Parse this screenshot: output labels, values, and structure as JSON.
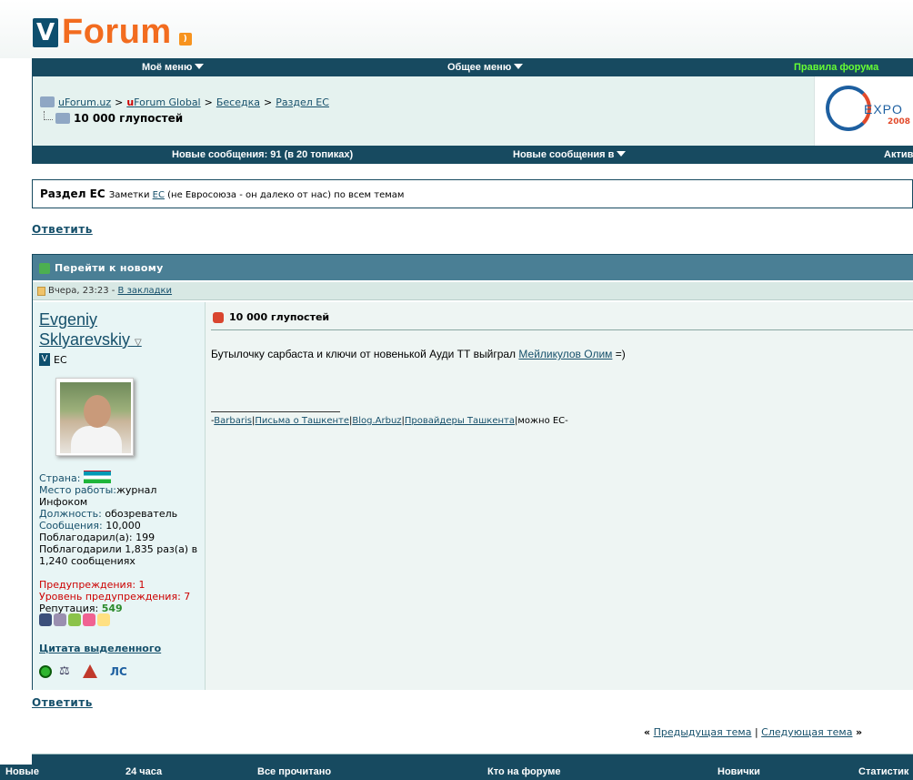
{
  "logo": {
    "mark": "V",
    "word": "Forum",
    "rss": "rss"
  },
  "menu": {
    "my_menu": "Моё меню",
    "general_menu": "Общее меню",
    "rules": "Правила форума",
    "rules_color": "#66ff33"
  },
  "breadcrumb": {
    "root": "uForum.uz",
    "global_u": "u",
    "global_rest": "Forum Global",
    "section1": "Беседка",
    "section2": "Раздел ЕС",
    "topic": "10 000 глупостей"
  },
  "banner": {
    "text": "EXPO",
    "year": "2008"
  },
  "statbar": {
    "new_posts": "Новые сообщения: 91 (в 20 топиках)",
    "new_in": "Новые сообщения в",
    "active": "Актив"
  },
  "section": {
    "title": "Раздел ЕС",
    "desc_pre": "Заметки ",
    "desc_link": "ЕС",
    "desc_post": " (не Евросоюза - он далеко от нас) по всем темам"
  },
  "reply_label": "Ответить",
  "post": {
    "header": "Перейти к новому",
    "date": "Вчера, 23:23 - ",
    "bookmark": "В закладки",
    "author_line1": "Evgeniy",
    "author_line2": "Sklyarevskiy",
    "group": "ЕС",
    "fields": {
      "country_k": "Страна:",
      "work_k": "Место работы:",
      "work_v": "журнал Инфоком",
      "position_k": "Должность:",
      "position_v": " обозреватель",
      "messages_k": "Сообщения:",
      "messages_v": " 10,000",
      "thanked": "Поблагодарил(а): 199",
      "thanked_by": "Поблагодарили 1,835 раз(а) в 1,240 сообщениях",
      "warnings": "Предупреждения: 1",
      "warn_level": "Уровень предупреждения: 7",
      "rep_k": "Репутация: ",
      "rep_v": "549"
    },
    "quote_selected": "Цитата выделенного",
    "pm": "ЛС",
    "title": "10 000 глупостей",
    "body_pre": "Бутылочку сарбаста и ключи от новенькой Ауди ТТ выйграл ",
    "body_link": "Мейликулов Олим",
    "body_post": " =)",
    "sig": {
      "pre": "-",
      "l1": "Barbaris",
      "l2": "Письма о Ташкенте",
      "l3": "Blog.Arbuz",
      "l4": "Провайдеры Ташкента",
      "post": "|можно ЕС-"
    }
  },
  "nav": {
    "prev": "Предыдущая тема",
    "sep": " | ",
    "next": "Следующая тема",
    "lq": "«",
    "rq": "»"
  },
  "bottom": {
    "new": "Новые",
    "h24": "24 часа",
    "all_read": "Все прочитано",
    "who": "Кто на форуме",
    "newbies": "Новички",
    "stats": "Статистик"
  }
}
